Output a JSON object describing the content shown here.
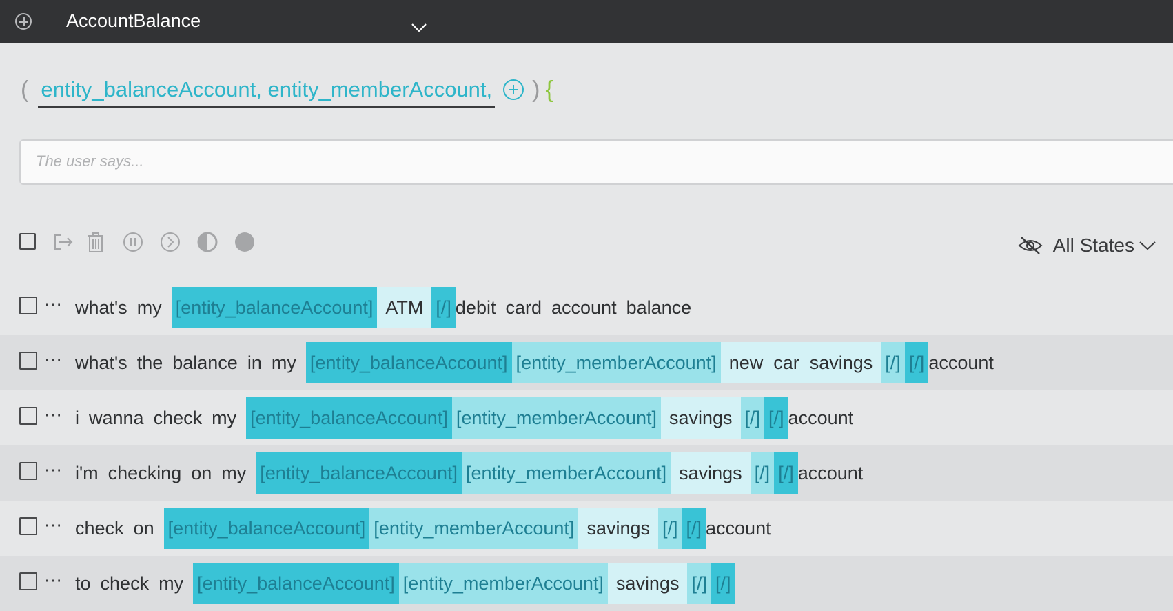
{
  "header": {
    "title": "AccountBalance"
  },
  "parameters": {
    "open": "(",
    "entities_text": "entity_balanceAccount, entity_memberAccount,",
    "close": ")",
    "brace": "{"
  },
  "user_says": {
    "placeholder": "The user says..."
  },
  "toolbar": {
    "states_label": "All States"
  },
  "rows": [
    {
      "parts": [
        {
          "kind": "word",
          "text": "what's"
        },
        {
          "kind": "word",
          "text": "my"
        },
        {
          "kind": "e1",
          "text": "[entity_balanceAccount]"
        },
        {
          "kind": "txt",
          "text": "ATM"
        },
        {
          "kind": "close1",
          "text": "[/]"
        },
        {
          "kind": "word",
          "text": "debit"
        },
        {
          "kind": "word",
          "text": "card"
        },
        {
          "kind": "word",
          "text": "account"
        },
        {
          "kind": "word",
          "text": "balance"
        }
      ]
    },
    {
      "parts": [
        {
          "kind": "word",
          "text": "what's"
        },
        {
          "kind": "word",
          "text": "the"
        },
        {
          "kind": "word",
          "text": "balance"
        },
        {
          "kind": "word",
          "text": "in"
        },
        {
          "kind": "word",
          "text": "my"
        },
        {
          "kind": "e1",
          "text": "[entity_balanceAccount]"
        },
        {
          "kind": "e2",
          "text": "[entity_memberAccount]"
        },
        {
          "kind": "txt",
          "text": "new  car  savings"
        },
        {
          "kind": "close2",
          "text": "[/]"
        },
        {
          "kind": "close1",
          "text": "[/]"
        },
        {
          "kind": "word",
          "text": "account"
        }
      ]
    },
    {
      "parts": [
        {
          "kind": "word",
          "text": "i"
        },
        {
          "kind": "word",
          "text": "wanna"
        },
        {
          "kind": "word",
          "text": "check"
        },
        {
          "kind": "word",
          "text": "my"
        },
        {
          "kind": "e1",
          "text": "[entity_balanceAccount]"
        },
        {
          "kind": "e2",
          "text": "[entity_memberAccount]"
        },
        {
          "kind": "txt",
          "text": "savings"
        },
        {
          "kind": "close2",
          "text": "[/]"
        },
        {
          "kind": "close1",
          "text": "[/]"
        },
        {
          "kind": "word",
          "text": "account"
        }
      ]
    },
    {
      "parts": [
        {
          "kind": "word",
          "text": "i'm"
        },
        {
          "kind": "word",
          "text": "checking"
        },
        {
          "kind": "word",
          "text": "on"
        },
        {
          "kind": "word",
          "text": "my"
        },
        {
          "kind": "e1",
          "text": "[entity_balanceAccount]"
        },
        {
          "kind": "e2",
          "text": "[entity_memberAccount]"
        },
        {
          "kind": "txt",
          "text": "savings"
        },
        {
          "kind": "close2",
          "text": "[/]"
        },
        {
          "kind": "close1",
          "text": "[/]"
        },
        {
          "kind": "word",
          "text": "account"
        }
      ]
    },
    {
      "parts": [
        {
          "kind": "word",
          "text": "check"
        },
        {
          "kind": "word",
          "text": "on"
        },
        {
          "kind": "e1",
          "text": "[entity_balanceAccount]"
        },
        {
          "kind": "e2",
          "text": "[entity_memberAccount]"
        },
        {
          "kind": "txt",
          "text": "savings"
        },
        {
          "kind": "close2",
          "text": "[/]"
        },
        {
          "kind": "close1",
          "text": "[/]"
        },
        {
          "kind": "word",
          "text": "account"
        }
      ]
    },
    {
      "parts": [
        {
          "kind": "word",
          "text": "to"
        },
        {
          "kind": "word",
          "text": "check"
        },
        {
          "kind": "word",
          "text": "my"
        },
        {
          "kind": "e1",
          "text": "[entity_balanceAccount]"
        },
        {
          "kind": "e2",
          "text": "[entity_memberAccount]"
        },
        {
          "kind": "txt",
          "text": "savings"
        },
        {
          "kind": "close2",
          "text": "[/]"
        },
        {
          "kind": "close1",
          "text": "[/]"
        }
      ]
    }
  ]
}
